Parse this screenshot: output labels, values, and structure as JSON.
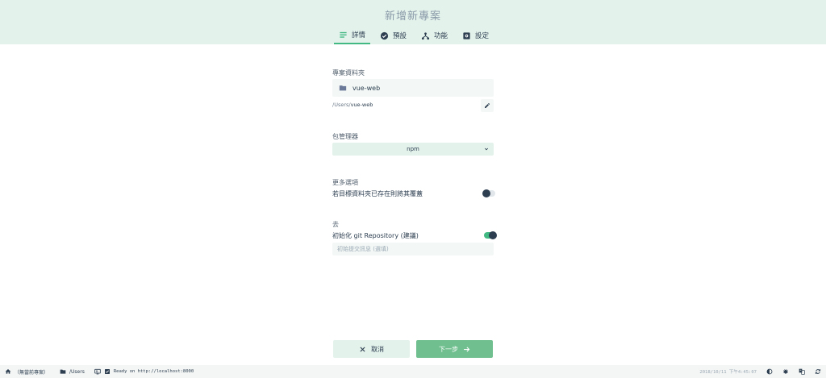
{
  "header": {
    "title": "新增新專案",
    "tabs": [
      {
        "label": "詳情",
        "icon": "details-icon",
        "active": true
      },
      {
        "label": "預設",
        "icon": "check-circle-icon",
        "active": false
      },
      {
        "label": "功能",
        "icon": "call-split-icon",
        "active": false
      },
      {
        "label": "設定",
        "icon": "settings-box-icon",
        "active": false
      }
    ]
  },
  "details": {
    "folder_label": "專案資料夾",
    "folder_value": "vue-web",
    "path_prefix": "/Users/",
    "path_name": "vue-web",
    "package_manager_label": "包管理器",
    "package_manager_value": "npm",
    "more_options_label": "更多選項",
    "overwrite_label": "若目標資料夾已存在則將其覆蓋",
    "overwrite_enabled": false,
    "git_section_label": "去",
    "git_init_label": "初始化 git Repository (建議)",
    "git_init_enabled": true,
    "commit_placeholder": "初始提交訊息 (選填)"
  },
  "actions": {
    "cancel_label": "取消",
    "next_label": "下一步"
  },
  "statusbar": {
    "no_project": "（無當前專案）",
    "cwd": "/Users",
    "log": "Ready on http://localhost:8000",
    "timestamp": "2018/10/11 下午4:45:07"
  },
  "colors": {
    "accent": "#42b983",
    "header_bg": "#e4f2ec",
    "text": "#2c3e50"
  }
}
